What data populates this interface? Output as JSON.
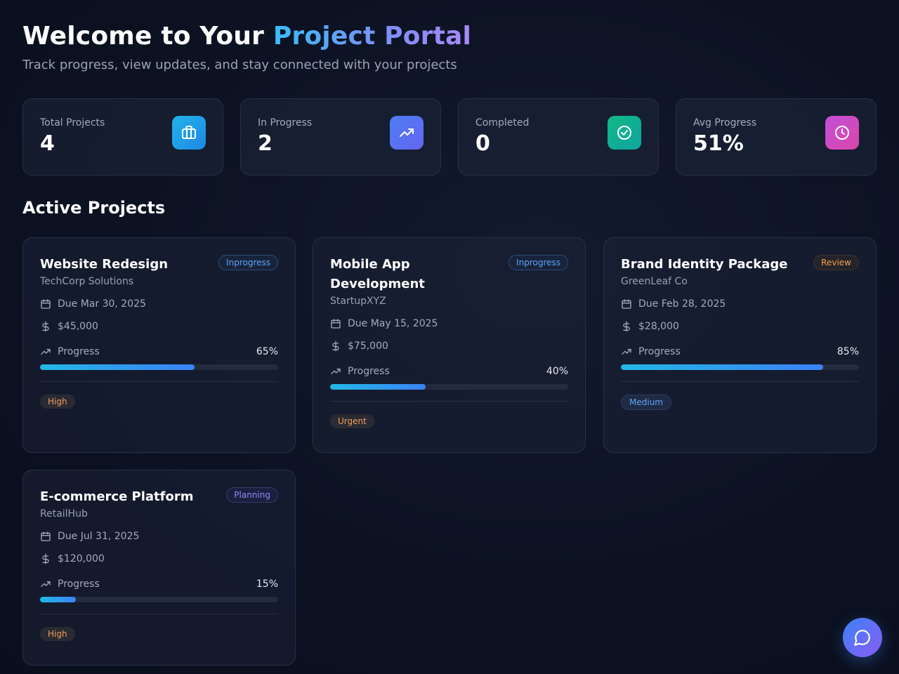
{
  "hero": {
    "title_plain": "Welcome to Your ",
    "title_accent": "Project Portal",
    "subtitle": "Track progress, view updates, and stay connected with your projects"
  },
  "stats": [
    {
      "label": "Total Projects",
      "value": "4",
      "icon": "briefcase-icon",
      "color": "#1ea7e6"
    },
    {
      "label": "In Progress",
      "value": "2",
      "icon": "trending-up-icon",
      "color": "#5b6cf0"
    },
    {
      "label": "Completed",
      "value": "0",
      "icon": "check-circle-icon",
      "color": "#10b08f"
    },
    {
      "label": "Avg Progress",
      "value": "51%",
      "icon": "clock-icon",
      "color": "#c04fd6"
    }
  ],
  "section": {
    "title": "Active Projects"
  },
  "projects": [
    {
      "title": "Website Redesign",
      "client": "TechCorp Solutions",
      "status": "Inprogress",
      "due": "Due Mar 30, 2025",
      "budget": "$45,000",
      "progress_label": "Progress",
      "progress_pct": "65%",
      "progress": 0.65,
      "priority": "High"
    },
    {
      "title": "Mobile App Development",
      "client": "StartupXYZ",
      "status": "Inprogress",
      "due": "Due May 15, 2025",
      "budget": "$75,000",
      "progress_label": "Progress",
      "progress_pct": "40%",
      "progress": 0.4,
      "priority": "Urgent"
    },
    {
      "title": "Brand Identity Package",
      "client": "GreenLeaf Co",
      "status": "Review",
      "due": "Due Feb 28, 2025",
      "budget": "$28,000",
      "progress_label": "Progress",
      "progress_pct": "85%",
      "progress": 0.85,
      "priority": "Medium"
    },
    {
      "title": "E-commerce Platform",
      "client": "RetailHub",
      "status": "Planning",
      "due": "Due Jul 31, 2025",
      "budget": "$120,000",
      "progress_label": "Progress",
      "progress_pct": "15%",
      "progress": 0.15,
      "priority": "High"
    }
  ],
  "colors": {
    "status_inprogress": "#60a5fa",
    "status_review": "#f5a04a",
    "status_planning": "#8b8cf8",
    "accent": "#3b82f6"
  },
  "chat": {
    "icon": "chat-bubble-icon"
  }
}
